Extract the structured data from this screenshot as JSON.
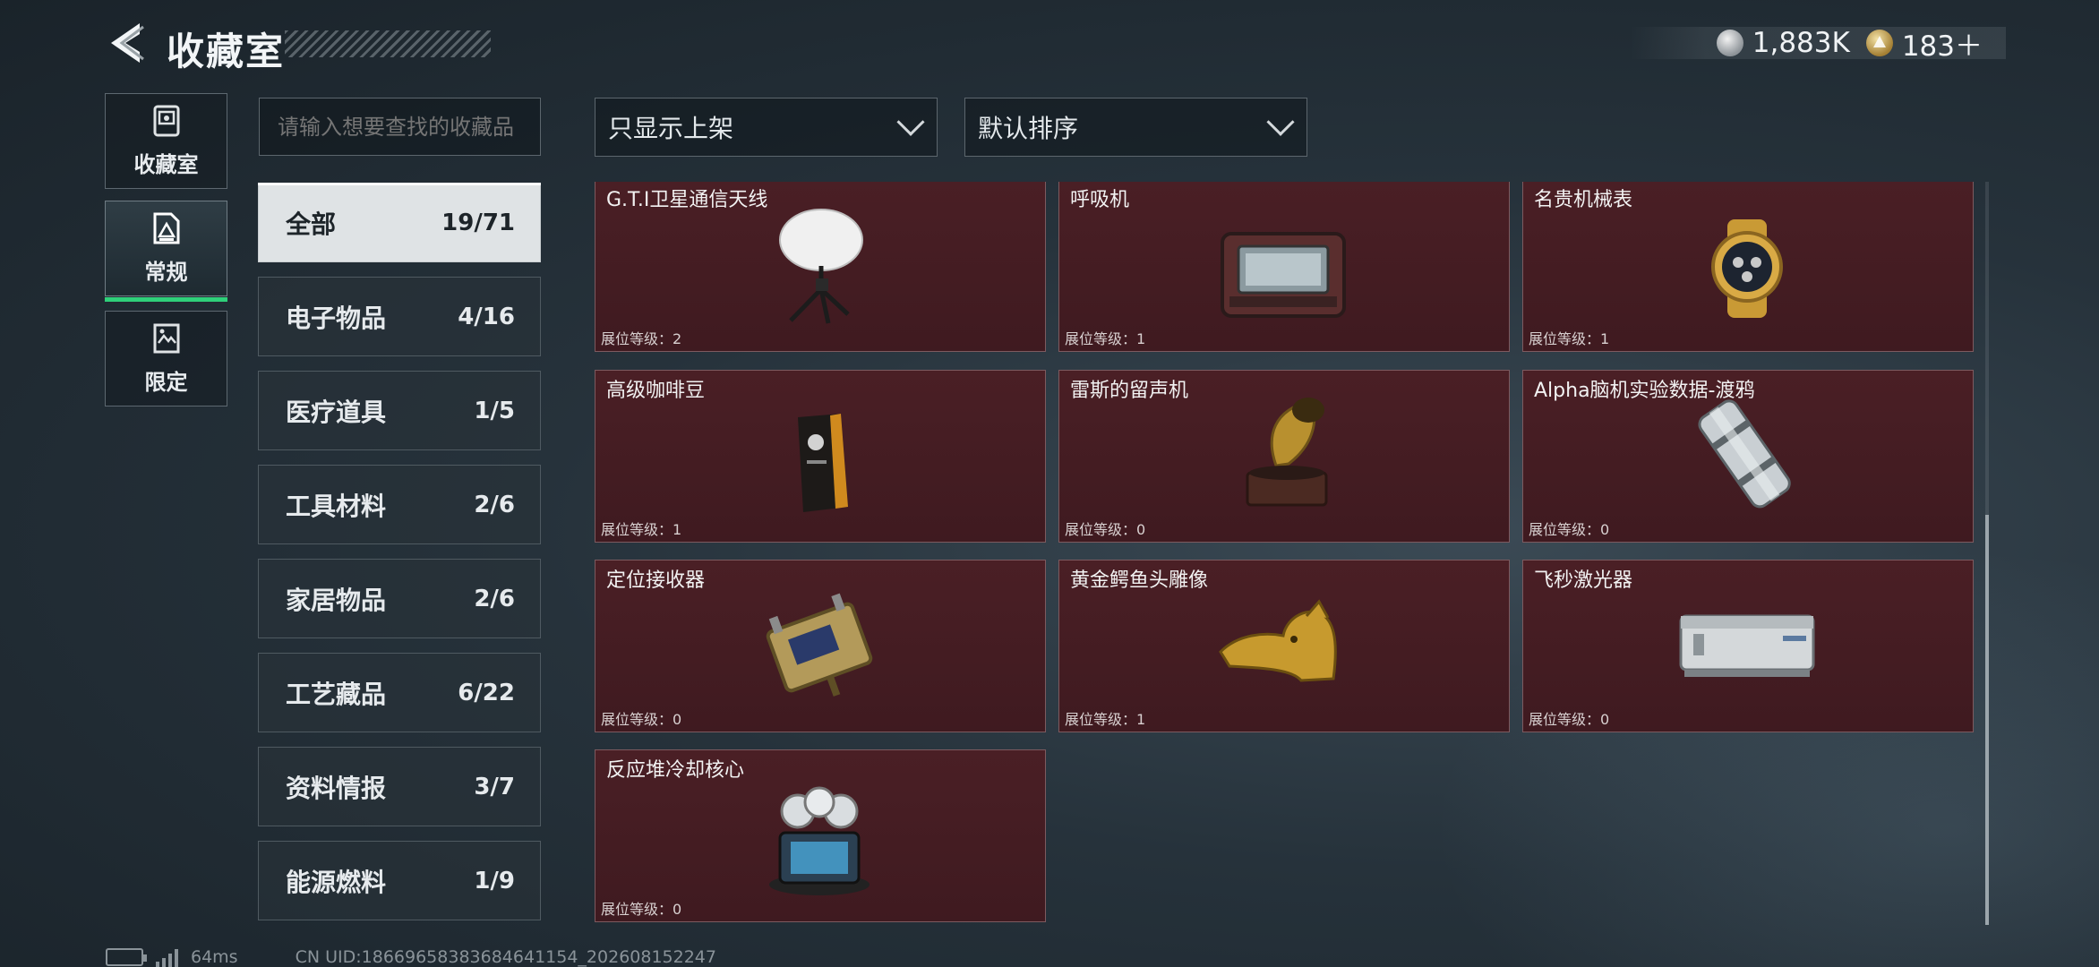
{
  "header": {
    "title": "收藏室",
    "currency": [
      {
        "icon": "silver-coin-icon",
        "value": "1,883K"
      },
      {
        "icon": "gold-coin-icon",
        "value": "183＋"
      }
    ]
  },
  "side_tabs": [
    {
      "label": "收藏室",
      "icon": "collection-room-icon",
      "active": false
    },
    {
      "label": "常规",
      "icon": "regular-icon",
      "active": true
    },
    {
      "label": "限定",
      "icon": "limited-icon",
      "active": false
    }
  ],
  "search": {
    "placeholder": "请输入想要查找的收藏品"
  },
  "filters": {
    "display_filter": "只显示上架",
    "sort": "默认排序"
  },
  "categories": [
    {
      "label": "全部",
      "count": "19/71",
      "active": true
    },
    {
      "label": "电子物品",
      "count": "4/16"
    },
    {
      "label": "医疗道具",
      "count": "1/5"
    },
    {
      "label": "工具材料",
      "count": "2/6"
    },
    {
      "label": "家居物品",
      "count": "2/6"
    },
    {
      "label": "工艺藏品",
      "count": "6/22"
    },
    {
      "label": "资料情报",
      "count": "3/7"
    },
    {
      "label": "能源燃料",
      "count": "1/9"
    }
  ],
  "items": [
    {
      "name": "G.T.I卫星通信天线",
      "level": "展位等级：2",
      "icon": "satellite-dish-icon"
    },
    {
      "name": "呼吸机",
      "level": "展位等级：1",
      "icon": "ventilator-icon"
    },
    {
      "name": "名贵机械表",
      "level": "展位等级：1",
      "icon": "luxury-watch-icon"
    },
    {
      "name": "高级咖啡豆",
      "level": "展位等级：1",
      "icon": "coffee-bean-bag-icon"
    },
    {
      "name": "雷斯的留声机",
      "level": "展位等级：0",
      "icon": "gramophone-icon"
    },
    {
      "name": "Alpha脑机实验数据-渡鸦",
      "level": "展位等级：0",
      "icon": "data-canister-icon"
    },
    {
      "name": "定位接收器",
      "level": "展位等级：0",
      "icon": "locator-receiver-icon"
    },
    {
      "name": "黄金鳄鱼头雕像",
      "level": "展位等级：1",
      "icon": "gold-crocodile-statue-icon"
    },
    {
      "name": "飞秒激光器",
      "level": "展位等级：0",
      "icon": "femtosecond-laser-icon"
    },
    {
      "name": "反应堆冷却核心",
      "level": "展位等级：0",
      "icon": "reactor-cooling-core-icon"
    }
  ],
  "status": {
    "latency": "64ms",
    "uid": "CN UID:18669658383684641154_202608152247"
  }
}
